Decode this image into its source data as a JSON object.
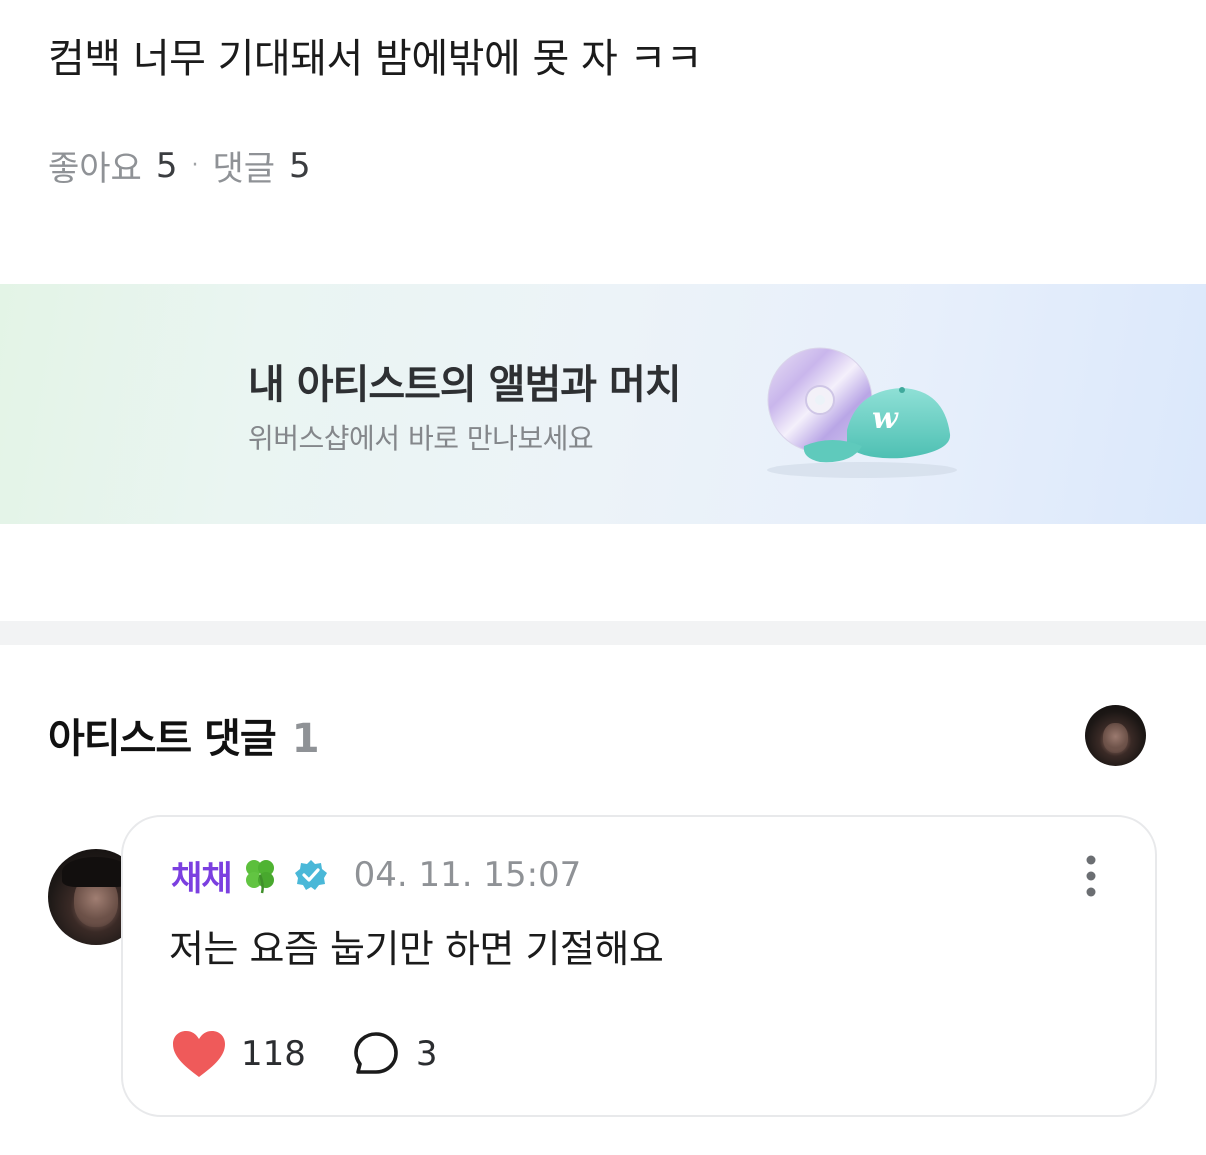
{
  "post": {
    "text": "컴백 너무 기대돼서 밤에밖에 못 자 ㅋㅋ",
    "likes_label": "좋아요",
    "likes_count": "5",
    "separator": "·",
    "comments_label": "댓글",
    "comments_count": "5"
  },
  "banner": {
    "title": "내 아티스트의 앨범과 머치",
    "subtitle": "위버스샵에서 바로 만나보세요",
    "icon": "album-cap-illustration"
  },
  "artist_comments": {
    "title": "아티스트 댓글",
    "count": "1",
    "comment": {
      "author": "채채",
      "author_icons": [
        "four-leaf-clover-icon",
        "verified-badge-icon"
      ],
      "timestamp": "04. 11. 15:07",
      "body": "저는 요즘 눕기만 하면 기절해요",
      "like_count": "118",
      "reply_count": "3"
    }
  },
  "colors": {
    "author_name": "#7b3fe0",
    "verified": "#4ab8d8",
    "heart": "#ef5a5a",
    "muted": "#8f9296"
  }
}
